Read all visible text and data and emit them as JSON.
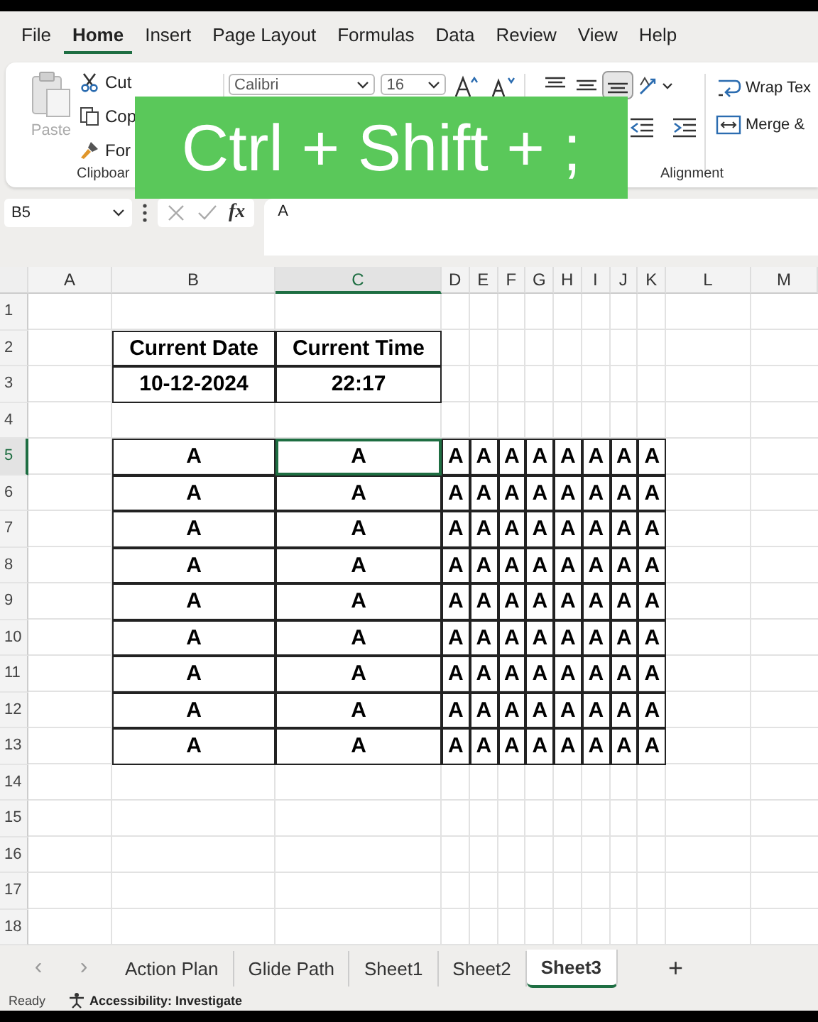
{
  "menu_tabs": [
    {
      "label": "File",
      "selected": false
    },
    {
      "label": "Home",
      "selected": true
    },
    {
      "label": "Insert",
      "selected": false
    },
    {
      "label": "Page Layout",
      "selected": false
    },
    {
      "label": "Formulas",
      "selected": false
    },
    {
      "label": "Data",
      "selected": false
    },
    {
      "label": "Review",
      "selected": false
    },
    {
      "label": "View",
      "selected": false
    },
    {
      "label": "Help",
      "selected": false
    }
  ],
  "ribbon": {
    "paste_label": "Paste",
    "clipboard_items": [
      "Cut",
      "Cop",
      "For"
    ],
    "clipboard_label": "Clipboar",
    "font_name": "Calibri",
    "font_size": "16",
    "alignment_buttons": [
      {
        "selected": false
      },
      {
        "selected": false
      },
      {
        "selected": true
      }
    ],
    "alignment_label": "Alignment",
    "wrap_label": "Wrap Tex",
    "merge_label": "Merge &"
  },
  "overlay": {
    "text": "Ctrl + Shift + ;"
  },
  "formula_bar": {
    "name_box": "B5",
    "function_label": "fx",
    "value": "A"
  },
  "columns": [
    {
      "label": "A",
      "selected": false
    },
    {
      "label": "B",
      "selected": false
    },
    {
      "label": "C",
      "selected": true
    },
    {
      "label": "D",
      "selected": false
    },
    {
      "label": "E",
      "selected": false
    },
    {
      "label": "F",
      "selected": false
    },
    {
      "label": "G",
      "selected": false
    },
    {
      "label": "H",
      "selected": false
    },
    {
      "label": "I",
      "selected": false
    },
    {
      "label": "J",
      "selected": false
    },
    {
      "label": "K",
      "selected": false
    },
    {
      "label": "L",
      "selected": false
    },
    {
      "label": "M",
      "selected": false
    }
  ],
  "rows": [
    {
      "label": "1",
      "selected": false,
      "cells": []
    },
    {
      "label": "2",
      "selected": false,
      "cells": [
        {
          "text": "Current Date",
          "selected": false
        },
        {
          "text": "Current Time",
          "selected": false
        }
      ]
    },
    {
      "label": "3",
      "selected": false,
      "cells": [
        {
          "text": "10-12-2024",
          "selected": false
        },
        {
          "text": "22:17",
          "selected": false
        }
      ]
    },
    {
      "label": "4",
      "selected": false,
      "cells": []
    },
    {
      "label": "5",
      "selected": true,
      "cells": [
        {
          "text": "A",
          "selected": false
        },
        {
          "text": "A",
          "selected": true
        },
        {
          "text": "A",
          "selected": false
        },
        {
          "text": "A",
          "selected": false
        },
        {
          "text": "A",
          "selected": false
        },
        {
          "text": "A",
          "selected": false
        },
        {
          "text": "A",
          "selected": false
        },
        {
          "text": "A",
          "selected": false
        },
        {
          "text": "A",
          "selected": false
        },
        {
          "text": "A",
          "selected": false
        }
      ]
    },
    {
      "label": "6",
      "selected": false,
      "cells": [
        {
          "text": "A",
          "selected": false
        },
        {
          "text": "A",
          "selected": false
        },
        {
          "text": "A",
          "selected": false
        },
        {
          "text": "A",
          "selected": false
        },
        {
          "text": "A",
          "selected": false
        },
        {
          "text": "A",
          "selected": false
        },
        {
          "text": "A",
          "selected": false
        },
        {
          "text": "A",
          "selected": false
        },
        {
          "text": "A",
          "selected": false
        },
        {
          "text": "A",
          "selected": false
        }
      ]
    },
    {
      "label": "7",
      "selected": false,
      "cells": [
        {
          "text": "A",
          "selected": false
        },
        {
          "text": "A",
          "selected": false
        },
        {
          "text": "A",
          "selected": false
        },
        {
          "text": "A",
          "selected": false
        },
        {
          "text": "A",
          "selected": false
        },
        {
          "text": "A",
          "selected": false
        },
        {
          "text": "A",
          "selected": false
        },
        {
          "text": "A",
          "selected": false
        },
        {
          "text": "A",
          "selected": false
        },
        {
          "text": "A",
          "selected": false
        }
      ]
    },
    {
      "label": "8",
      "selected": false,
      "cells": [
        {
          "text": "A",
          "selected": false
        },
        {
          "text": "A",
          "selected": false
        },
        {
          "text": "A",
          "selected": false
        },
        {
          "text": "A",
          "selected": false
        },
        {
          "text": "A",
          "selected": false
        },
        {
          "text": "A",
          "selected": false
        },
        {
          "text": "A",
          "selected": false
        },
        {
          "text": "A",
          "selected": false
        },
        {
          "text": "A",
          "selected": false
        },
        {
          "text": "A",
          "selected": false
        }
      ]
    },
    {
      "label": "9",
      "selected": false,
      "cells": [
        {
          "text": "A",
          "selected": false
        },
        {
          "text": "A",
          "selected": false
        },
        {
          "text": "A",
          "selected": false
        },
        {
          "text": "A",
          "selected": false
        },
        {
          "text": "A",
          "selected": false
        },
        {
          "text": "A",
          "selected": false
        },
        {
          "text": "A",
          "selected": false
        },
        {
          "text": "A",
          "selected": false
        },
        {
          "text": "A",
          "selected": false
        },
        {
          "text": "A",
          "selected": false
        }
      ]
    },
    {
      "label": "10",
      "selected": false,
      "cells": [
        {
          "text": "A",
          "selected": false
        },
        {
          "text": "A",
          "selected": false
        },
        {
          "text": "A",
          "selected": false
        },
        {
          "text": "A",
          "selected": false
        },
        {
          "text": "A",
          "selected": false
        },
        {
          "text": "A",
          "selected": false
        },
        {
          "text": "A",
          "selected": false
        },
        {
          "text": "A",
          "selected": false
        },
        {
          "text": "A",
          "selected": false
        },
        {
          "text": "A",
          "selected": false
        }
      ]
    },
    {
      "label": "11",
      "selected": false,
      "cells": [
        {
          "text": "A",
          "selected": false
        },
        {
          "text": "A",
          "selected": false
        },
        {
          "text": "A",
          "selected": false
        },
        {
          "text": "A",
          "selected": false
        },
        {
          "text": "A",
          "selected": false
        },
        {
          "text": "A",
          "selected": false
        },
        {
          "text": "A",
          "selected": false
        },
        {
          "text": "A",
          "selected": false
        },
        {
          "text": "A",
          "selected": false
        },
        {
          "text": "A",
          "selected": false
        }
      ]
    },
    {
      "label": "12",
      "selected": false,
      "cells": [
        {
          "text": "A",
          "selected": false
        },
        {
          "text": "A",
          "selected": false
        },
        {
          "text": "A",
          "selected": false
        },
        {
          "text": "A",
          "selected": false
        },
        {
          "text": "A",
          "selected": false
        },
        {
          "text": "A",
          "selected": false
        },
        {
          "text": "A",
          "selected": false
        },
        {
          "text": "A",
          "selected": false
        },
        {
          "text": "A",
          "selected": false
        },
        {
          "text": "A",
          "selected": false
        }
      ]
    },
    {
      "label": "13",
      "selected": false,
      "cells": [
        {
          "text": "A",
          "selected": false
        },
        {
          "text": "A",
          "selected": false
        },
        {
          "text": "A",
          "selected": false
        },
        {
          "text": "A",
          "selected": false
        },
        {
          "text": "A",
          "selected": false
        },
        {
          "text": "A",
          "selected": false
        },
        {
          "text": "A",
          "selected": false
        },
        {
          "text": "A",
          "selected": false
        },
        {
          "text": "A",
          "selected": false
        },
        {
          "text": "A",
          "selected": false
        }
      ]
    },
    {
      "label": "14",
      "selected": false,
      "cells": []
    },
    {
      "label": "15",
      "selected": false,
      "cells": []
    },
    {
      "label": "16",
      "selected": false,
      "cells": []
    },
    {
      "label": "17",
      "selected": false,
      "cells": []
    },
    {
      "label": "18",
      "selected": false,
      "cells": []
    }
  ],
  "sheet_nav": {
    "previous": "‹",
    "next": "›",
    "add": "+"
  },
  "sheet_tabs": [
    {
      "label": "Action Plan",
      "selected": false
    },
    {
      "label": "Glide Path",
      "selected": false
    },
    {
      "label": "Sheet1",
      "selected": false
    },
    {
      "label": "Sheet2",
      "selected": false
    },
    {
      "label": "Sheet3",
      "selected": true
    }
  ],
  "status_bar": {
    "mode": "Ready",
    "accessibility": "Accessibility: Investigate"
  }
}
